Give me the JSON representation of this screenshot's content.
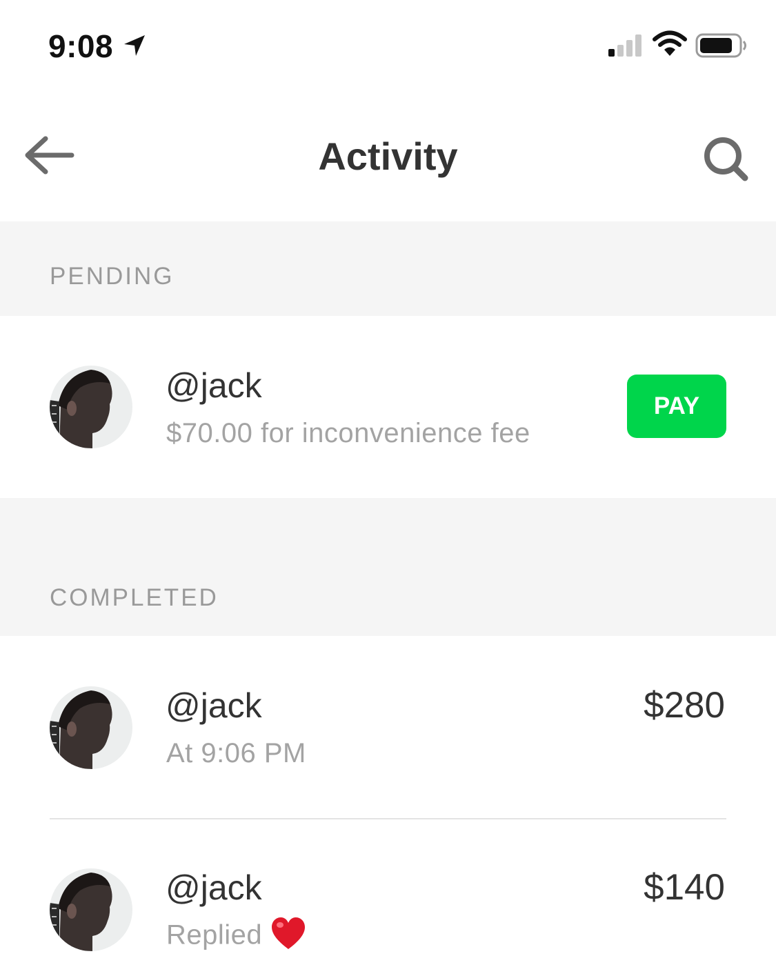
{
  "status_bar": {
    "time": "9:08",
    "icons": [
      "location-arrow-icon",
      "cellular-signal-icon",
      "wifi-icon",
      "battery-icon"
    ]
  },
  "nav": {
    "title": "Activity",
    "left_icon": "back-arrow-icon",
    "right_icon": "search-icon"
  },
  "sections": {
    "pending": {
      "label": "PENDING",
      "items": [
        {
          "name": "@jack",
          "subtitle": "$70.00 for inconvenience fee",
          "action_label": "PAY"
        }
      ]
    },
    "completed": {
      "label": "COMPLETED",
      "items": [
        {
          "name": "@jack",
          "subtitle": "At 9:06 PM",
          "amount": "$280"
        },
        {
          "name": "@jack",
          "subtitle": "Replied",
          "amount": "$140",
          "subtitle_icon": "heart-icon"
        }
      ]
    }
  },
  "colors": {
    "accent_green": "#00d54b",
    "section_background": "#f5f5f5",
    "secondary_text": "#a3a3a3",
    "heart": "#e0182a"
  }
}
